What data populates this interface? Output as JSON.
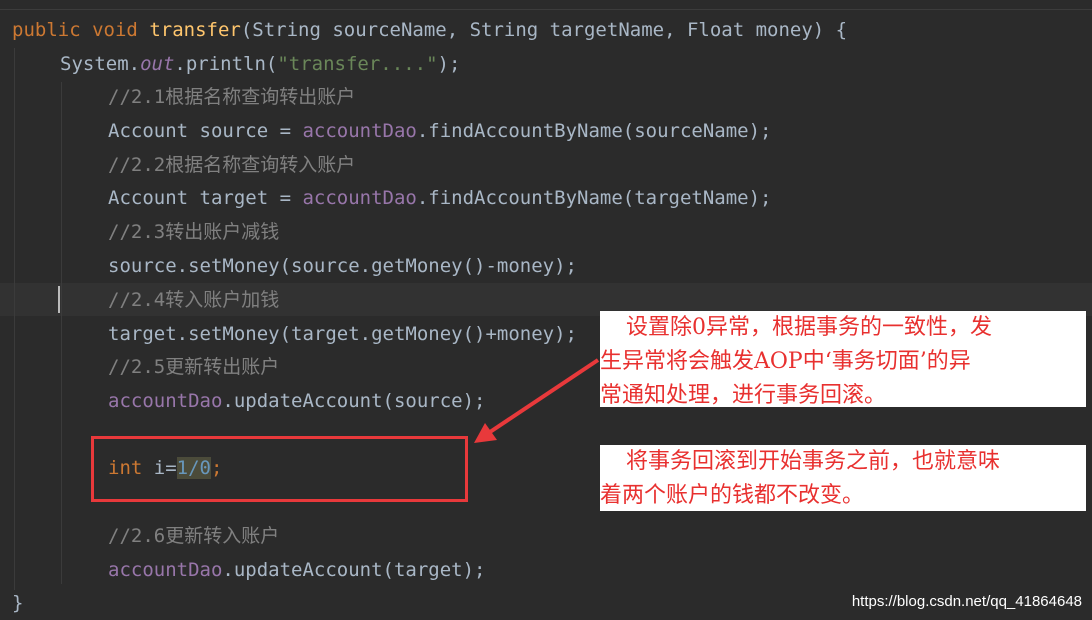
{
  "code": {
    "sig_public": "public",
    "sig_void": "void",
    "sig_method": "transfer",
    "sig_params_1": "(String sourceName, String targetName, Float money) {",
    "println_prefix": "System.",
    "println_out": "out",
    "println_mid": ".println(",
    "println_str": "\"transfer....\"",
    "println_end": ");",
    "c21": "//2.1根据名称查询转出账户",
    "l_source_a": "Account source = ",
    "l_source_dao": "accountDao",
    "l_source_b": ".findAccountByName(sourceName);",
    "c22": "//2.2根据名称查询转入账户",
    "l_target_a": "Account target = ",
    "l_target_dao": "accountDao",
    "l_target_b": ".findAccountByName(targetName);",
    "c23": "//2.3转出账户减钱",
    "l_setsrc": "source.setMoney(source.getMoney()-money);",
    "c24": "//2.4转入账户加钱",
    "l_settgt": "target.setMoney(target.getMoney()+money);",
    "c25": "//2.5更新转出账户",
    "l_upd1_dao": "accountDao",
    "l_upd1_b": ".updateAccount(source);",
    "l_int_kw": "int",
    "l_int_var": " i=",
    "l_int_val": "1/0",
    "l_int_end": ";",
    "c26": "//2.6更新转入账户",
    "l_upd2_dao": "accountDao",
    "l_upd2_b": ".updateAccount(target);",
    "close_brace": "}"
  },
  "annotations": {
    "note1_line1": "设置除0异常，根据事务的一致性，发",
    "note1_line2": "生异常将会触发AOP中‘事务切面’的异",
    "note1_line3": "常通知处理，进行事务回滚。",
    "note2_line1": "将事务回滚到开始事务之前，也就意味",
    "note2_line2": "着两个账户的钱都不改变。"
  },
  "watermark": "https://blog.csdn.net/qq_41864648",
  "colors": {
    "background": "#2b2b2b",
    "keyword": "#cc7832",
    "method": "#ffc66d",
    "string": "#6a8759",
    "comment": "#808080",
    "field": "#9876aa",
    "number": "#6897bb",
    "annotation_red": "#e8302f"
  }
}
